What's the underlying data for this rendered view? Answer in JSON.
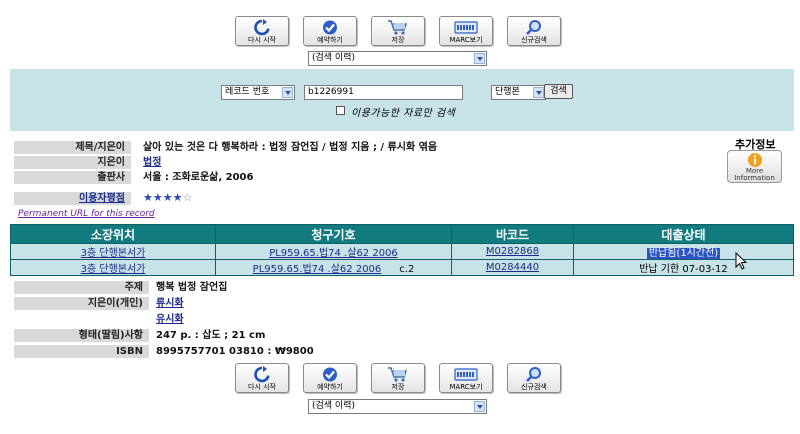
{
  "toolbar": [
    {
      "label": "다시 시작",
      "icon": "refresh-icon"
    },
    {
      "label": "예약하기",
      "icon": "check-icon"
    },
    {
      "label": "저장",
      "icon": "cart-icon"
    },
    {
      "label": "MARC보기",
      "icon": "marc-icon"
    },
    {
      "label": "신규검색",
      "icon": "magnifier-icon"
    }
  ],
  "history_select": {
    "value": "(검색 이력)"
  },
  "search": {
    "field_select": "레코드 번호",
    "query": "b1226991",
    "type_select": "단행본",
    "button": "검색",
    "available_only_label": "이용가능한 자료만 검색"
  },
  "extra_info": {
    "label": "추가정보",
    "icon_text_1": "More",
    "icon_text_2": "Information"
  },
  "record": {
    "title_label": "제목/지은이",
    "title_value": "살아 있는 것은 다 행복하라 : 법정 잠언집 / 법정 지음 ; / 류시화 엮음",
    "author_label": "지은이",
    "author_value": "법정",
    "publisher_label": "출판사",
    "publisher_value": "서울 : 조화로운삶, 2006",
    "rating_label": "이용자평점",
    "rating_stars": 4,
    "rating_max": 5,
    "permalink": "Permanent URL for this record"
  },
  "holdings": {
    "headers": [
      "소장위치",
      "청구기호",
      "바코드",
      "대출상태"
    ],
    "rows": [
      {
        "location": "3층 단행본서가",
        "call": "PL959.65.법74 .살62 2006",
        "copy": "",
        "barcode": "M0282868",
        "status": "반납됨(1시간전)"
      },
      {
        "location": "3층 단행본서가",
        "call": "PL959.65.법74 .살62 2006",
        "copy": "c.2",
        "barcode": "M0284440",
        "status": "반납 기한 07-03-12"
      }
    ]
  },
  "details": {
    "subject_label": "주제",
    "subject_value": "행복 법정 잠언집",
    "person_label": "지은이(개인)",
    "person_value_1": "류시화",
    "person_value_2": "유시화",
    "form_label": "형태(딸림)사항",
    "form_value": "247 p. : 삽도 ; 21 cm",
    "isbn_label": "ISBN",
    "isbn_value": "8995757701 03810 : ₩9800"
  }
}
